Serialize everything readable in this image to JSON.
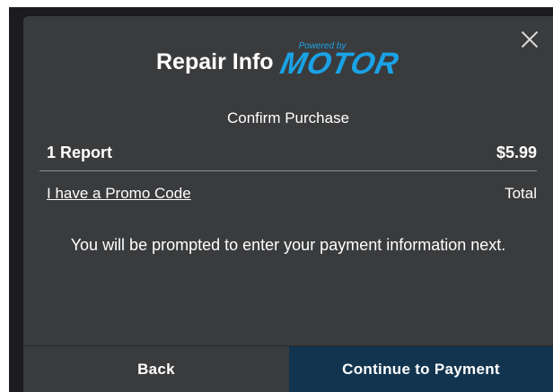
{
  "modal": {
    "title": "Repair Info",
    "logo": {
      "tagline": "Powered by",
      "brand": "MOTOR",
      "color": "#1aa3e6"
    },
    "close_icon": "close-icon"
  },
  "purchase": {
    "heading": "Confirm Purchase",
    "item_label": "1 Report",
    "item_price": "$5.99",
    "promo_link": "I have a Promo Code",
    "total_label": "Total",
    "notice": "You will be prompted to enter your payment information next."
  },
  "footer": {
    "back_label": "Back",
    "continue_label": "Continue to Payment",
    "continue_color": "#12344f"
  }
}
